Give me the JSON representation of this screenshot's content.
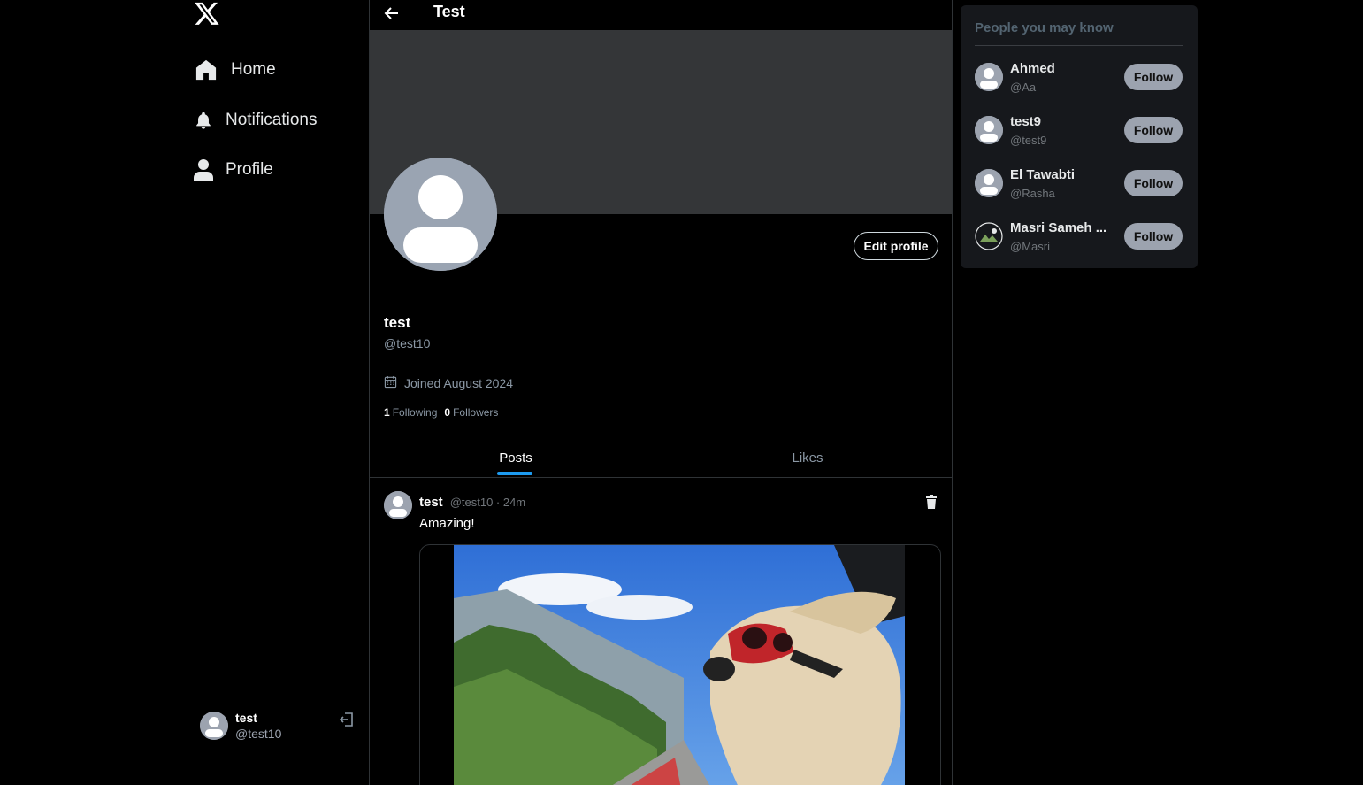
{
  "sidebar": {
    "logo": "x-logo-icon",
    "nav": [
      {
        "label": "Home",
        "icon": "home-icon"
      },
      {
        "label": "Notifications",
        "icon": "bell-icon"
      },
      {
        "label": "Profile",
        "icon": "user-icon"
      }
    ],
    "current_user": {
      "name": "test",
      "handle": "@test10"
    }
  },
  "header": {
    "title": "Test"
  },
  "profile": {
    "name": "test",
    "handle": "@test10",
    "edit_label": "Edit profile",
    "joined": "Joined August 2024",
    "following_count": "1",
    "following_label": "Following",
    "followers_count": "0",
    "followers_label": "Followers",
    "banner_color": "#343638"
  },
  "tabs": [
    {
      "label": "Posts",
      "active": true
    },
    {
      "label": "Likes",
      "active": false
    }
  ],
  "post": {
    "name": "test",
    "meta": "@test10 · 24m",
    "text": "Amazing!"
  },
  "suggestions": {
    "title": "People you may know",
    "follow_label": "Follow",
    "people": [
      {
        "name": "Ahmed",
        "handle": "@Aa"
      },
      {
        "name": "test9",
        "handle": "@test9"
      },
      {
        "name": "El Tawabti",
        "handle": "@Rasha"
      },
      {
        "name": "Masri Sameh ...",
        "handle": "@Masri"
      }
    ]
  },
  "colors": {
    "accent": "#1d9bf0",
    "background": "#000000",
    "panel": "#16181c"
  }
}
